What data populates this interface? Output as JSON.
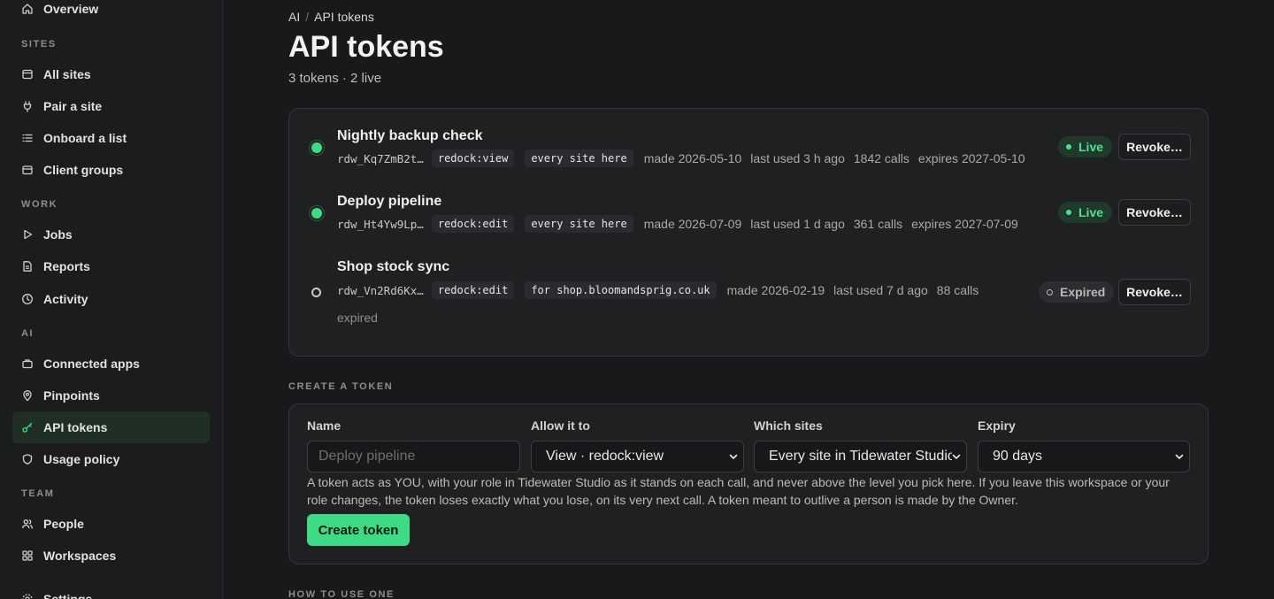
{
  "sidebar": {
    "top_item": "Overview",
    "sections": [
      {
        "label": "SITES",
        "items": [
          "All sites",
          "Pair a site",
          "Onboard a list",
          "Client groups"
        ]
      },
      {
        "label": "WORK",
        "items": [
          "Jobs",
          "Reports",
          "Activity"
        ]
      },
      {
        "label": "AI",
        "items": [
          "Connected apps",
          "Pinpoints",
          "API tokens",
          "Usage policy"
        ]
      },
      {
        "label": "TEAM",
        "items": [
          "People",
          "Workspaces"
        ]
      }
    ],
    "bottom_item": "Settings",
    "active_item": "API tokens"
  },
  "breadcrumb": {
    "parent": "AI",
    "separator": "/",
    "current": "API tokens"
  },
  "page": {
    "title": "API tokens",
    "subtitle": "3 tokens · 2 live"
  },
  "tokens": [
    {
      "name": "Nightly backup check",
      "id": "rdw_Kq7ZmB2t…",
      "scope": "redock:view",
      "sites": "every site here",
      "made": "made 2026-05-10",
      "last_used": "last used 3 h ago",
      "calls": "1842 calls",
      "expires": "expires 2027-05-10",
      "note": "",
      "status": "Live",
      "revoke": "Revoke…"
    },
    {
      "name": "Deploy pipeline",
      "id": "rdw_Ht4Yw9Lp…",
      "scope": "redock:edit",
      "sites": "every site here",
      "made": "made 2026-07-09",
      "last_used": "last used 1 d ago",
      "calls": "361 calls",
      "expires": "expires 2027-07-09",
      "note": "",
      "status": "Live",
      "revoke": "Revoke…"
    },
    {
      "name": "Shop stock sync",
      "id": "rdw_Vn2Rd6Kx…",
      "scope": "redock:edit",
      "sites": "for shop.bloomandsprig.co.uk",
      "made": "made 2026-02-19",
      "last_used": "last used 7 d ago",
      "calls": "88 calls",
      "expires": "",
      "note": "expired",
      "status": "Expired",
      "revoke": "Revoke…"
    }
  ],
  "create": {
    "heading": "CREATE A TOKEN",
    "name_label": "Name",
    "name_placeholder": "Deploy pipeline",
    "allow_label": "Allow it to",
    "allow_value": "View · redock:view",
    "sites_label": "Which sites",
    "sites_value": "Every site in Tidewater Studio",
    "expiry_label": "Expiry",
    "expiry_value": "90 days",
    "help": "A token acts as YOU, with your role in Tidewater Studio as it stands on each call, and never above the level you pick here. If you leave this workspace or your role changes, the token loses exactly what you lose, on its very next call. A token meant to outlive a person is made by the Owner.",
    "button": "Create token"
  },
  "how_heading": "HOW TO USE ONE",
  "colors": {
    "accent": "#3ddc84",
    "background": "#18191b",
    "card": "#1f2022"
  }
}
